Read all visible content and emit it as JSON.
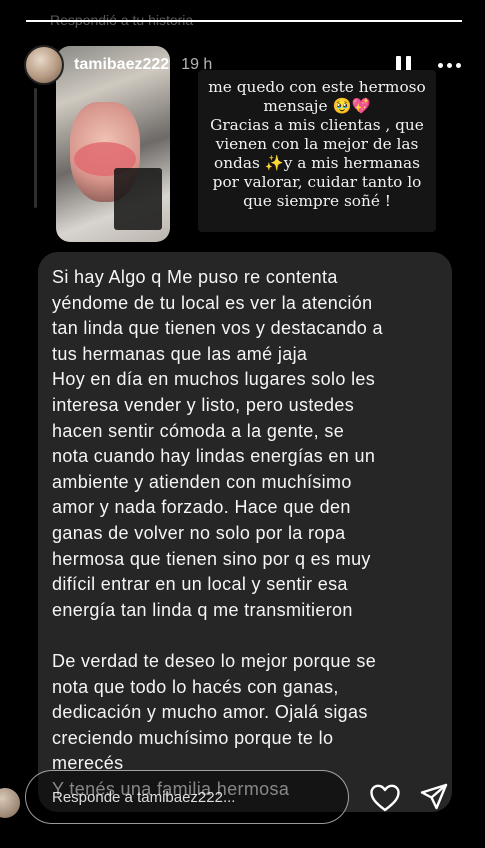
{
  "progress": {
    "fraction": 1.0
  },
  "replied_label": "Respondió a tu historia",
  "header": {
    "username": "tamibaez222",
    "time": "19 h",
    "pause_icon": "pause-icon",
    "more_icon": "more-options-icon"
  },
  "story": {
    "text_lines": [
      "me quedo con este hermoso",
      "mensaje 🥹💖",
      "Gracias a mis clientas , que",
      "vienen con la mejor de las",
      "ondas ✨y a mis hermanas",
      "por valorar, cuidar tanto lo",
      "que siempre soñé !"
    ]
  },
  "message": {
    "lines": [
      "Si hay Algo q Me puso re contenta",
      "yéndome de tu local   es ver la atención",
      "tan linda que tienen vos y destacando a",
      "tus hermanas  que las amé jaja",
      "Hoy en día en muchos lugares solo les",
      "interesa vender y listo, pero ustedes",
      "hacen sentir cómoda a la gente, se",
      "nota cuando hay lindas energías en un",
      "ambiente y atienden con muchísimo",
      "amor y nada forzado. Hace que den",
      "ganas de volver no solo por la ropa",
      "hermosa que tienen sino por q es muy",
      "difícil entrar en un local y sentir esa",
      "energía tan linda q me transmitieron",
      "",
      "De verdad te deseo lo mejor porque se",
      "nota que todo lo hacés con ganas,",
      "dedicación y mucho amor. Ojalá sigas",
      "creciendo muchísimo porque te lo",
      "merecés",
      "Y tenés una familia hermosa"
    ]
  },
  "reply": {
    "placeholder": "Responde a tamibaez222..."
  },
  "icons": {
    "heart": "heart-icon",
    "send": "send-icon"
  }
}
